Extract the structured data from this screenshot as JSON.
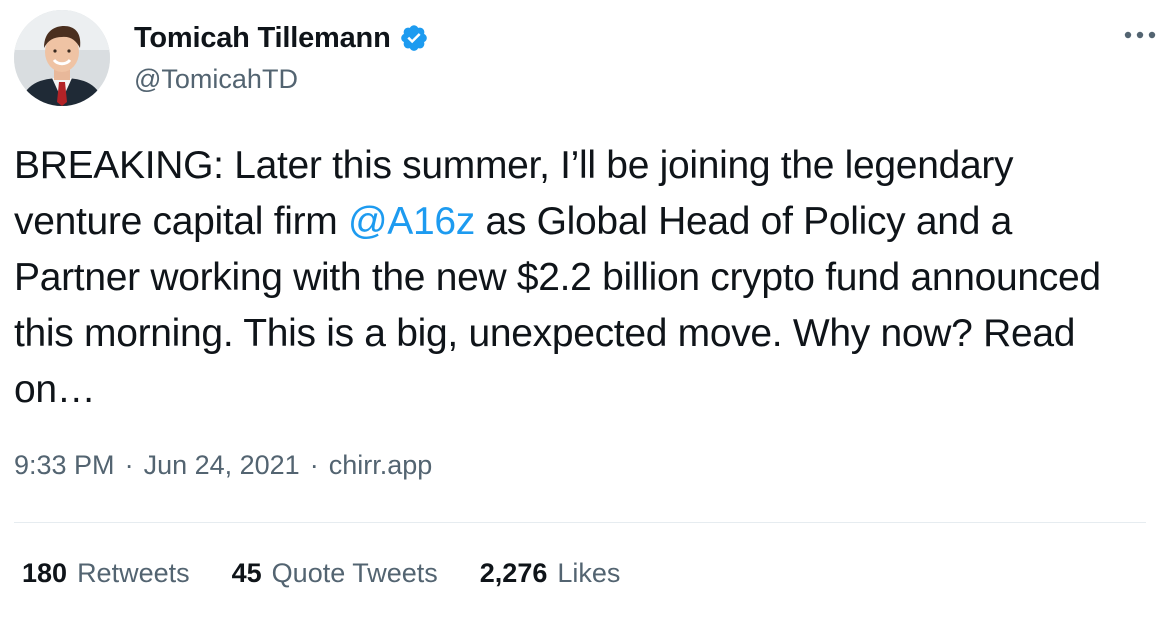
{
  "author": {
    "display_name": "Tomicah Tillemann",
    "handle": "@TomicahTD",
    "verified_icon": "verified-badge-icon",
    "avatar_icon": "avatar-photo"
  },
  "menu": {
    "more_icon": "more-options-icon",
    "more_label": "···"
  },
  "tweet": {
    "text_before": "BREAKING: Later this summer, I’ll be joining the legendary venture capital firm ",
    "mention": "@A16z",
    "text_after": " as Global Head of Policy and a Partner working with the new $2.2 billion crypto fund announced this morning. This is a big, unexpected move. Why now? Read on…"
  },
  "meta": {
    "time": "9:33 PM",
    "date": "Jun 24, 2021",
    "source": "chirr.app",
    "separator": "·"
  },
  "stats": {
    "retweets_count": "180",
    "retweets_label": "Retweets",
    "quotes_count": "45",
    "quotes_label": "Quote Tweets",
    "likes_count": "2,276",
    "likes_label": "Likes"
  },
  "colors": {
    "text_primary": "#0f1419",
    "text_secondary": "#536471",
    "accent": "#1d9bf0",
    "divider": "#e6ecf0"
  }
}
